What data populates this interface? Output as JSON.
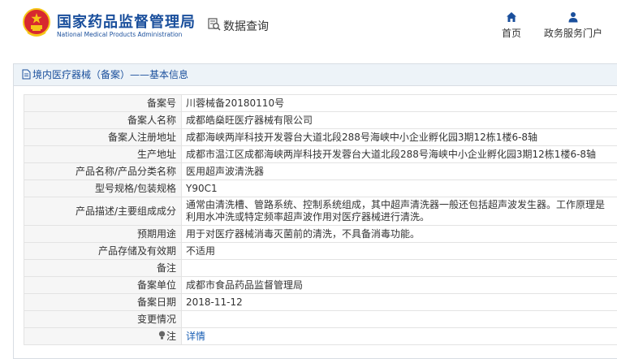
{
  "header": {
    "site_title_cn": "国家药品监督管理局",
    "site_title_en": "National Medical Products Administration",
    "app_title": "数据查询",
    "nav": [
      {
        "label": "首页",
        "icon": "home-icon"
      },
      {
        "label": "政务服务门户",
        "icon": "user-icon"
      }
    ]
  },
  "panel": {
    "breadcrumb": "境内医疗器械（备案）——基本信息"
  },
  "record": {
    "rows": [
      {
        "label": "备案号",
        "value": "川蓉械备20180110号"
      },
      {
        "label": "备案人名称",
        "value": "成都皓燊旺医疗器械有限公司"
      },
      {
        "label": "备案人注册地址",
        "value": "成都海峡两岸科技开发蓉台大道北段288号海峡中小企业孵化园3期12栋1楼6-8轴"
      },
      {
        "label": "生产地址",
        "value": "成都市温江区成都海峡两岸科技开发蓉台大道北段288号海峡中小企业孵化园3期12栋1楼6-8轴"
      },
      {
        "label": "产品名称/产品分类名称",
        "value": "医用超声波清洗器"
      },
      {
        "label": "型号规格/包装规格",
        "value": "Y90C1"
      },
      {
        "label": "产品描述/主要组成成分",
        "value": "通常由清洗槽、管路系统、控制系统组成，其中超声清洗器一般还包括超声波发生器。工作原理是利用水冲洗或特定频率超声波作用对医疗器械进行清洗。"
      },
      {
        "label": "预期用途",
        "value": "用于对医疗器械消毒灭菌前的清洗，不具备消毒功能。"
      },
      {
        "label": "产品存储及有效期",
        "value": "不适用"
      },
      {
        "label": "备注",
        "value": ""
      },
      {
        "label": "备案单位",
        "value": "成都市食品药品监督管理局"
      },
      {
        "label": "备案日期",
        "value": "2018-11-12"
      },
      {
        "label": "变更情况",
        "value": ""
      },
      {
        "label": "注",
        "value": "详情",
        "icon": "lightbulb-icon"
      }
    ]
  },
  "colors": {
    "brand_blue": "#1a4f9c",
    "emblem_red": "#d7282f",
    "emblem_gold": "#f5c518",
    "link": "#1a5fb4"
  }
}
